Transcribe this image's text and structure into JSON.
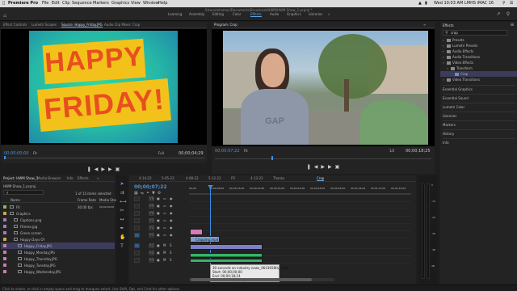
{
  "macos": {
    "app_name": "Premiere Pro",
    "menus": [
      "File",
      "Edit",
      "Clip",
      "Sequence",
      "Markers",
      "Graphics",
      "View",
      "Window",
      "Help"
    ],
    "clock": "Wed 10:03 AM",
    "user": "LMHS iMAC 16"
  },
  "title_path": "/Users/mhsmac/Documents/Broadcast/HWM/HWM Show_1.prproj *",
  "workspaces": [
    "Learning",
    "Assembly",
    "Editing",
    "Color",
    "Effects",
    "Audio",
    "Graphics",
    "Libraries"
  ],
  "active_workspace": "Effects",
  "source_panel": {
    "tabs": [
      "Effect Controls",
      "Lumetri Scopes",
      "Source: Happy_Friday.JPG",
      "Audio Clip Mixer: Crop"
    ],
    "clip_text_line1": "HAPPY",
    "clip_text_line2": "FRIDAY!",
    "timecode_left": "00;00;00;00",
    "fit": "Fit",
    "zoom_level": "Full",
    "timecode_right": "00;00;04;29"
  },
  "program_panel": {
    "tab": "Program: Crop",
    "timecode_left": "00;00;07;22",
    "fit": "Fit",
    "zoom_level": "1/2",
    "timecode_right": "00;00;18;25"
  },
  "effects_panel": {
    "title": "Effects",
    "search_value": "crop",
    "tree": [
      {
        "label": "Presets",
        "indent": 0
      },
      {
        "label": "Lumetri Presets",
        "indent": 0
      },
      {
        "label": "Audio Effects",
        "indent": 0
      },
      {
        "label": "Audio Transitions",
        "indent": 0
      },
      {
        "label": "Video Effects",
        "indent": 0
      },
      {
        "label": "Transform",
        "indent": 1
      },
      {
        "label": "Crop",
        "indent": 2,
        "selected": true
      },
      {
        "label": "Video Transitions",
        "indent": 0
      }
    ],
    "sections": [
      "Essential Graphics",
      "Essential Sound",
      "Lumetri Color",
      "Libraries",
      "Markers",
      "History",
      "Info"
    ]
  },
  "project_panel": {
    "tabs": [
      "Project: HWM Show_1",
      "Media Browser",
      "Info",
      "Effects",
      "Markers",
      "History"
    ],
    "project_file": "HWM Show_1.prproj",
    "items_count": "1 of 15 items selected",
    "columns": [
      "Name",
      "Frame Rate",
      "Media Start"
    ],
    "rows": [
      {
        "name": "Fit",
        "rate": "30.00 fps",
        "start": "00;00;00;00",
        "indent": 0,
        "color": "#7dbe5a"
      },
      {
        "name": "Graphics",
        "rate": "",
        "start": "",
        "indent": 0,
        "color": "#c9a64c"
      },
      {
        "name": "Captions.png",
        "rate": "",
        "start": "",
        "indent": 1,
        "color": "#9d7ac7"
      },
      {
        "name": "Fitness.jpg",
        "rate": "",
        "start": "",
        "indent": 1,
        "color": "#9d7ac7"
      },
      {
        "name": "Green screen",
        "rate": "",
        "start": "",
        "indent": 1,
        "color": "#9d7ac7"
      },
      {
        "name": "Happy Days Of",
        "rate": "",
        "start": "",
        "indent": 1,
        "color": "#c9a64c"
      },
      {
        "name": "Happy_Friday.JPG",
        "rate": "",
        "start": "",
        "indent": 2,
        "color": "#c77ab0",
        "selected": true
      },
      {
        "name": "Happy_Monday.JPG",
        "rate": "",
        "start": "",
        "indent": 2,
        "color": "#c77ab0"
      },
      {
        "name": "Happy_Thursday.JPG",
        "rate": "",
        "start": "",
        "indent": 2,
        "color": "#c77ab0"
      },
      {
        "name": "Happy_Tuesday.JPG",
        "rate": "",
        "start": "",
        "indent": 2,
        "color": "#c77ab0"
      },
      {
        "name": "Happy_Wednesday.JPG",
        "rate": "",
        "start": "",
        "indent": 2,
        "color": "#c77ab0"
      }
    ]
  },
  "timeline": {
    "tabs": [
      "4-14-22",
      "5-05-22",
      "4-08-22",
      "5-12-22",
      "FR",
      "4-13-22",
      "Thanks",
      "Crop"
    ],
    "active_tab": "Crop",
    "timecode": "00;00;07;22",
    "ruler": [
      "00;00",
      "00;00;08;00",
      "00;00;16;00",
      "00;00;24;00",
      "00;00;32;00",
      "00;00;40;00",
      "00;00;48;00",
      "00;00;56;00",
      "00;01;04;02",
      "00;01;12;02",
      "00;01;20;02"
    ],
    "video_tracks": [
      "V6",
      "V5",
      "V4",
      "V3",
      "V2",
      "V1"
    ],
    "audio_tracks": [
      "A1",
      "A2",
      "A3"
    ],
    "clip_labels": [
      "Crop",
      "Cropping.mp4",
      "",
      "",
      ""
    ],
    "tooltip": {
      "line1": "30 seconds on industry news_0641658fa_.mp4",
      "line2": "Start: 00;00;00;00",
      "line3": "End: 00;00;18;24",
      "line4": "Duration: 00;00;18;25"
    }
  },
  "status_bar": "Click to select, or click in empty space and drag to marquee select. Use Shift, Opt, and Cmd for other options.",
  "meter_labels": [
    "0",
    "-12",
    "-24",
    "-36",
    "-48",
    "dB"
  ],
  "colors": {
    "accent": "#2d8ceb",
    "timecode": "#4f90d9",
    "playhead": "#3d8ee6"
  }
}
